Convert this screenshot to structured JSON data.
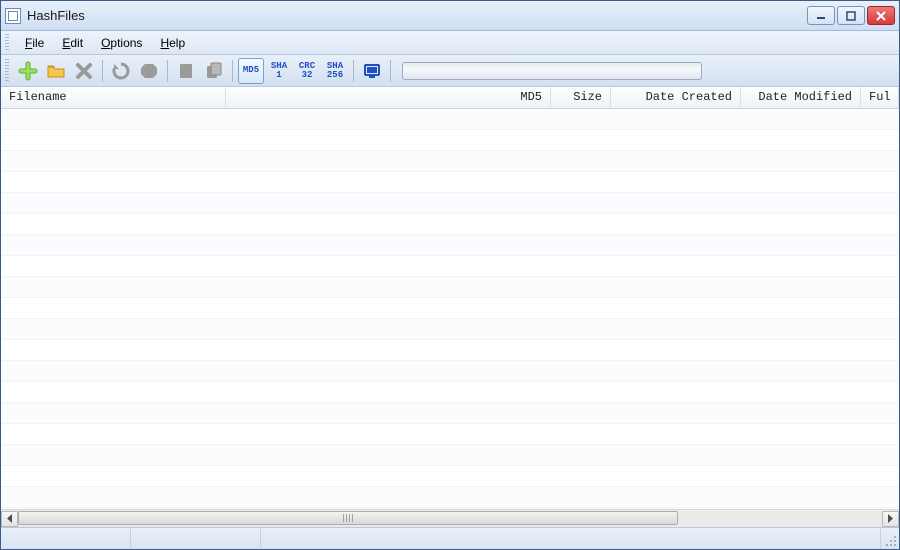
{
  "window": {
    "title": "HashFiles"
  },
  "menu": {
    "file": "File",
    "file_accel": "F",
    "edit": "Edit",
    "edit_accel": "E",
    "options": "Options",
    "options_accel": "O",
    "help": "Help",
    "help_accel": "H"
  },
  "toolbar": {
    "hash_buttons": {
      "md5": {
        "line1": "MD5",
        "line2": ""
      },
      "sha1": {
        "line1": "SHA",
        "line2": "1"
      },
      "crc32": {
        "line1": "CRC",
        "line2": "32"
      },
      "sha256": {
        "line1": "SHA",
        "line2": "256"
      }
    }
  },
  "columns": {
    "filename": "Filename",
    "md5": "MD5",
    "size": "Size",
    "date_created": "Date Created",
    "date_modified": "Date Modified",
    "full": "Ful"
  },
  "rows": []
}
